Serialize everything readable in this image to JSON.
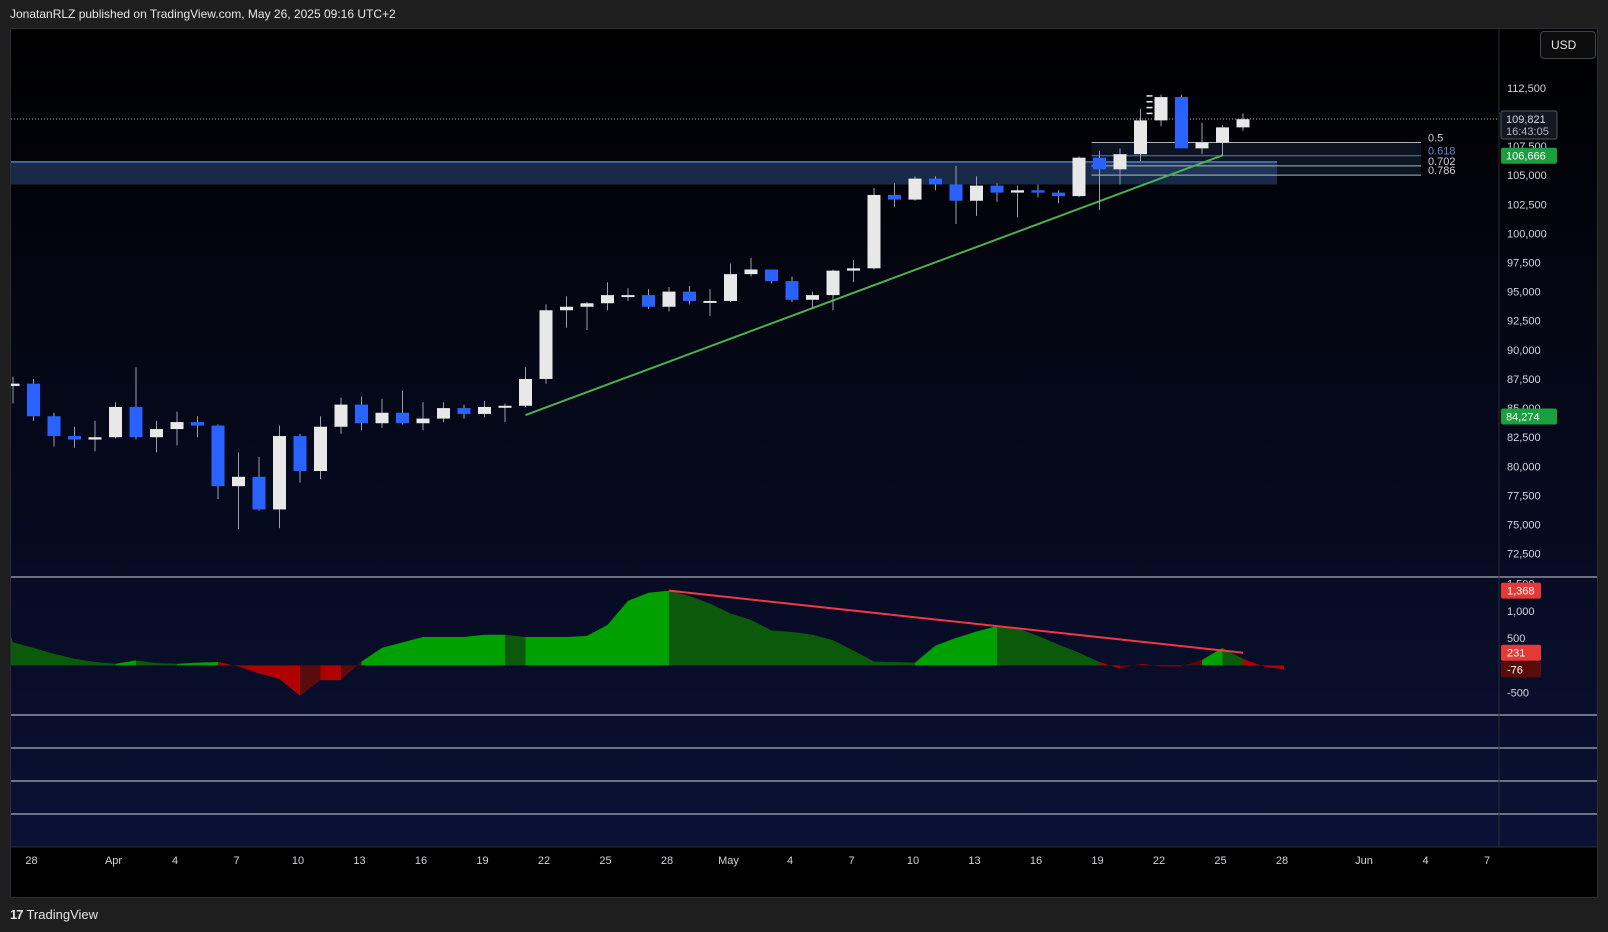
{
  "header": {
    "publisher_line": "JonatanRLZ published on TradingView.com, May 26, 2025 09:16 UTC+2"
  },
  "footer": {
    "logo_mark": "17",
    "logo_text": "TradingView"
  },
  "currency_button": {
    "label": "USD"
  },
  "colors": {
    "bull_candle": "#e8e8e8",
    "bear_candle": "#2962ff",
    "support_line": "#4caf50",
    "divergence_line": "#f23645",
    "zone_fill": "#2a4a7a",
    "osc_bright_green": "#00a000",
    "osc_dark_green": "#0b5a0b",
    "osc_red": "#b00000",
    "osc_dark_red": "#5a0c0c"
  },
  "price_axis": {
    "labels": [
      "112,500",
      "110,000",
      "107,500",
      "105,000",
      "102,500",
      "100,000",
      "97,500",
      "95,000",
      "92,500",
      "90,000",
      "87,500",
      "85,000",
      "82,500",
      "80,000",
      "77,500",
      "75,000",
      "72,500"
    ],
    "badges": [
      {
        "text": "109,821",
        "sub": "16:43:05",
        "style": "dark"
      },
      {
        "text": "106,666",
        "style": "green"
      },
      {
        "text": "84,274",
        "style": "green"
      }
    ]
  },
  "oscillator_axis": {
    "labels": [
      "1,500",
      "1,000",
      "500",
      "-500"
    ],
    "badges": [
      {
        "text": "1,368",
        "style": "red"
      },
      {
        "text": "231",
        "style": "red"
      },
      {
        "text": "-76",
        "style": "darkred"
      }
    ]
  },
  "time_axis": [
    "28",
    "Apr",
    "4",
    "7",
    "10",
    "13",
    "16",
    "19",
    "22",
    "25",
    "28",
    "May",
    "4",
    "7",
    "10",
    "13",
    "16",
    "19",
    "22",
    "25",
    "28",
    "Jun",
    "4",
    "7"
  ],
  "fib_levels": [
    {
      "label": "0.5",
      "value": 107800,
      "color": "#d1d4dc"
    },
    {
      "label": "0.618",
      "value": 106666,
      "color": "#5b8fd6"
    },
    {
      "label": "0.702",
      "value": 105800,
      "color": "#d1d4dc"
    },
    {
      "label": "0.786",
      "value": 105000,
      "color": "#d1d4dc"
    }
  ],
  "chart_data": {
    "type": "candlestick",
    "title": "",
    "y_range": [
      70500,
      116000
    ],
    "ylabel": "USD",
    "current_price": 109821,
    "zone": {
      "from": 104200,
      "to": 106200
    },
    "candles": [
      {
        "date": "Mar 27",
        "o": 86900,
        "h": 87700,
        "l": 85400,
        "c": 87100
      },
      {
        "date": "Mar 28",
        "o": 87100,
        "h": 87500,
        "l": 83900,
        "c": 84300
      },
      {
        "date": "Mar 29",
        "o": 84300,
        "h": 84600,
        "l": 81700,
        "c": 82600
      },
      {
        "date": "Mar 30",
        "o": 82600,
        "h": 83400,
        "l": 81600,
        "c": 82300
      },
      {
        "date": "Mar 31",
        "o": 82300,
        "h": 83900,
        "l": 81300,
        "c": 82500
      },
      {
        "date": "Apr 1",
        "o": 82500,
        "h": 85500,
        "l": 82400,
        "c": 85100
      },
      {
        "date": "Apr 2",
        "o": 85100,
        "h": 88500,
        "l": 82300,
        "c": 82500
      },
      {
        "date": "Apr 3",
        "o": 82500,
        "h": 83900,
        "l": 81200,
        "c": 83200
      },
      {
        "date": "Apr 4",
        "o": 83200,
        "h": 84700,
        "l": 81800,
        "c": 83800
      },
      {
        "date": "Apr 5",
        "o": 83800,
        "h": 84300,
        "l": 82500,
        "c": 83500
      },
      {
        "date": "Apr 6",
        "o": 83500,
        "h": 83600,
        "l": 77200,
        "c": 78300
      },
      {
        "date": "Apr 7",
        "o": 78300,
        "h": 81200,
        "l": 74600,
        "c": 79100
      },
      {
        "date": "Apr 8",
        "o": 79100,
        "h": 80800,
        "l": 76200,
        "c": 76300
      },
      {
        "date": "Apr 9",
        "o": 76300,
        "h": 83500,
        "l": 74700,
        "c": 82600
      },
      {
        "date": "Apr 10",
        "o": 82600,
        "h": 82800,
        "l": 78600,
        "c": 79600
      },
      {
        "date": "Apr 11",
        "o": 79600,
        "h": 84300,
        "l": 78900,
        "c": 83400
      },
      {
        "date": "Apr 12",
        "o": 83400,
        "h": 85900,
        "l": 82800,
        "c": 85300
      },
      {
        "date": "Apr 13",
        "o": 85300,
        "h": 86000,
        "l": 83100,
        "c": 83700
      },
      {
        "date": "Apr 14",
        "o": 83700,
        "h": 85800,
        "l": 83300,
        "c": 84600
      },
      {
        "date": "Apr 15",
        "o": 84600,
        "h": 86500,
        "l": 83600,
        "c": 83700
      },
      {
        "date": "Apr 16",
        "o": 83700,
        "h": 85500,
        "l": 83100,
        "c": 84100
      },
      {
        "date": "Apr 17",
        "o": 84100,
        "h": 85500,
        "l": 83800,
        "c": 85000
      },
      {
        "date": "Apr 18",
        "o": 85000,
        "h": 85300,
        "l": 84100,
        "c": 84500
      },
      {
        "date": "Apr 19",
        "o": 84500,
        "h": 85600,
        "l": 84200,
        "c": 85100
      },
      {
        "date": "Apr 20",
        "o": 85100,
        "h": 85400,
        "l": 83800,
        "c": 85200
      },
      {
        "date": "Apr 21",
        "o": 85200,
        "h": 88500,
        "l": 85100,
        "c": 87500
      },
      {
        "date": "Apr 22",
        "o": 87500,
        "h": 93900,
        "l": 87100,
        "c": 93400
      },
      {
        "date": "Apr 23",
        "o": 93400,
        "h": 94600,
        "l": 91900,
        "c": 93700
      },
      {
        "date": "Apr 24",
        "o": 93700,
        "h": 94100,
        "l": 91700,
        "c": 94000
      },
      {
        "date": "Apr 25",
        "o": 94000,
        "h": 95800,
        "l": 93400,
        "c": 94700
      },
      {
        "date": "Apr 26",
        "o": 94700,
        "h": 95300,
        "l": 94200,
        "c": 94700
      },
      {
        "date": "Apr 27",
        "o": 94700,
        "h": 95200,
        "l": 93500,
        "c": 93700
      },
      {
        "date": "Apr 28",
        "o": 93700,
        "h": 95400,
        "l": 93300,
        "c": 95000
      },
      {
        "date": "Apr 29",
        "o": 95000,
        "h": 95500,
        "l": 93900,
        "c": 94200
      },
      {
        "date": "Apr 30",
        "o": 94200,
        "h": 95200,
        "l": 92900,
        "c": 94200
      },
      {
        "date": "May 1",
        "o": 94200,
        "h": 97400,
        "l": 94100,
        "c": 96500
      },
      {
        "date": "May 2",
        "o": 96500,
        "h": 97900,
        "l": 96300,
        "c": 96900
      },
      {
        "date": "May 3",
        "o": 96900,
        "h": 96900,
        "l": 95700,
        "c": 95900
      },
      {
        "date": "May 4",
        "o": 95900,
        "h": 96300,
        "l": 94100,
        "c": 94300
      },
      {
        "date": "May 5",
        "o": 94300,
        "h": 95000,
        "l": 93500,
        "c": 94700
      },
      {
        "date": "May 6",
        "o": 94700,
        "h": 96900,
        "l": 93400,
        "c": 96800
      },
      {
        "date": "May 7",
        "o": 96800,
        "h": 97700,
        "l": 95800,
        "c": 97000
      },
      {
        "date": "May 8",
        "o": 97000,
        "h": 103900,
        "l": 96900,
        "c": 103300
      },
      {
        "date": "May 9",
        "o": 103300,
        "h": 104300,
        "l": 102300,
        "c": 102900
      },
      {
        "date": "May 10",
        "o": 102900,
        "h": 104900,
        "l": 102800,
        "c": 104700
      },
      {
        "date": "May 11",
        "o": 104700,
        "h": 104900,
        "l": 103700,
        "c": 104200
      },
      {
        "date": "May 12",
        "o": 104200,
        "h": 105800,
        "l": 100800,
        "c": 102800
      },
      {
        "date": "May 13",
        "o": 102800,
        "h": 104900,
        "l": 101500,
        "c": 104100
      },
      {
        "date": "May 14",
        "o": 104100,
        "h": 104300,
        "l": 102700,
        "c": 103500
      },
      {
        "date": "May 15",
        "o": 103500,
        "h": 104100,
        "l": 101400,
        "c": 103700
      },
      {
        "date": "May 16",
        "o": 103700,
        "h": 104200,
        "l": 103100,
        "c": 103500
      },
      {
        "date": "May 17",
        "o": 103500,
        "h": 103700,
        "l": 102600,
        "c": 103200
      },
      {
        "date": "May 18",
        "o": 103200,
        "h": 106600,
        "l": 103100,
        "c": 106500
      },
      {
        "date": "May 19",
        "o": 106500,
        "h": 107100,
        "l": 102000,
        "c": 105500
      },
      {
        "date": "May 20",
        "o": 105500,
        "h": 107300,
        "l": 104200,
        "c": 106800
      },
      {
        "date": "May 21",
        "o": 106800,
        "h": 110700,
        "l": 106200,
        "c": 109700
      },
      {
        "date": "May 22",
        "o": 109700,
        "h": 111900,
        "l": 109200,
        "c": 111700
      },
      {
        "date": "May 23",
        "o": 111700,
        "h": 111900,
        "l": 107300,
        "c": 107300
      },
      {
        "date": "May 24",
        "o": 107300,
        "h": 109500,
        "l": 106800,
        "c": 107800
      },
      {
        "date": "May 25",
        "o": 107800,
        "h": 109300,
        "l": 106600,
        "c": 109100
      },
      {
        "date": "May 26",
        "o": 109100,
        "h": 110300,
        "l": 108800,
        "c": 109800
      }
    ],
    "support_line": {
      "from": {
        "date": "Apr 21",
        "value": 84400
      },
      "to": {
        "date": "May 25",
        "value": 106700
      }
    },
    "oscillator": {
      "y_range": [
        -800,
        1600
      ],
      "values": [
        420,
        320,
        210,
        120,
        60,
        30,
        90,
        40,
        30,
        50,
        60,
        -20,
        -150,
        -250,
        -560,
        -270,
        -270,
        70,
        320,
        420,
        520,
        520,
        520,
        560,
        560,
        520,
        520,
        520,
        540,
        740,
        1180,
        1330,
        1368,
        1270,
        1130,
        950,
        830,
        640,
        610,
        560,
        460,
        270,
        70,
        60,
        50,
        360,
        500,
        620,
        720,
        680,
        540,
        380,
        230,
        60,
        -60,
        30,
        -20,
        -20,
        100,
        320,
        120,
        -20,
        -76
      ],
      "divergence_line": {
        "from": {
          "index": 32,
          "value": 1368
        },
        "to": {
          "index": 60,
          "value": 231
        }
      }
    }
  }
}
